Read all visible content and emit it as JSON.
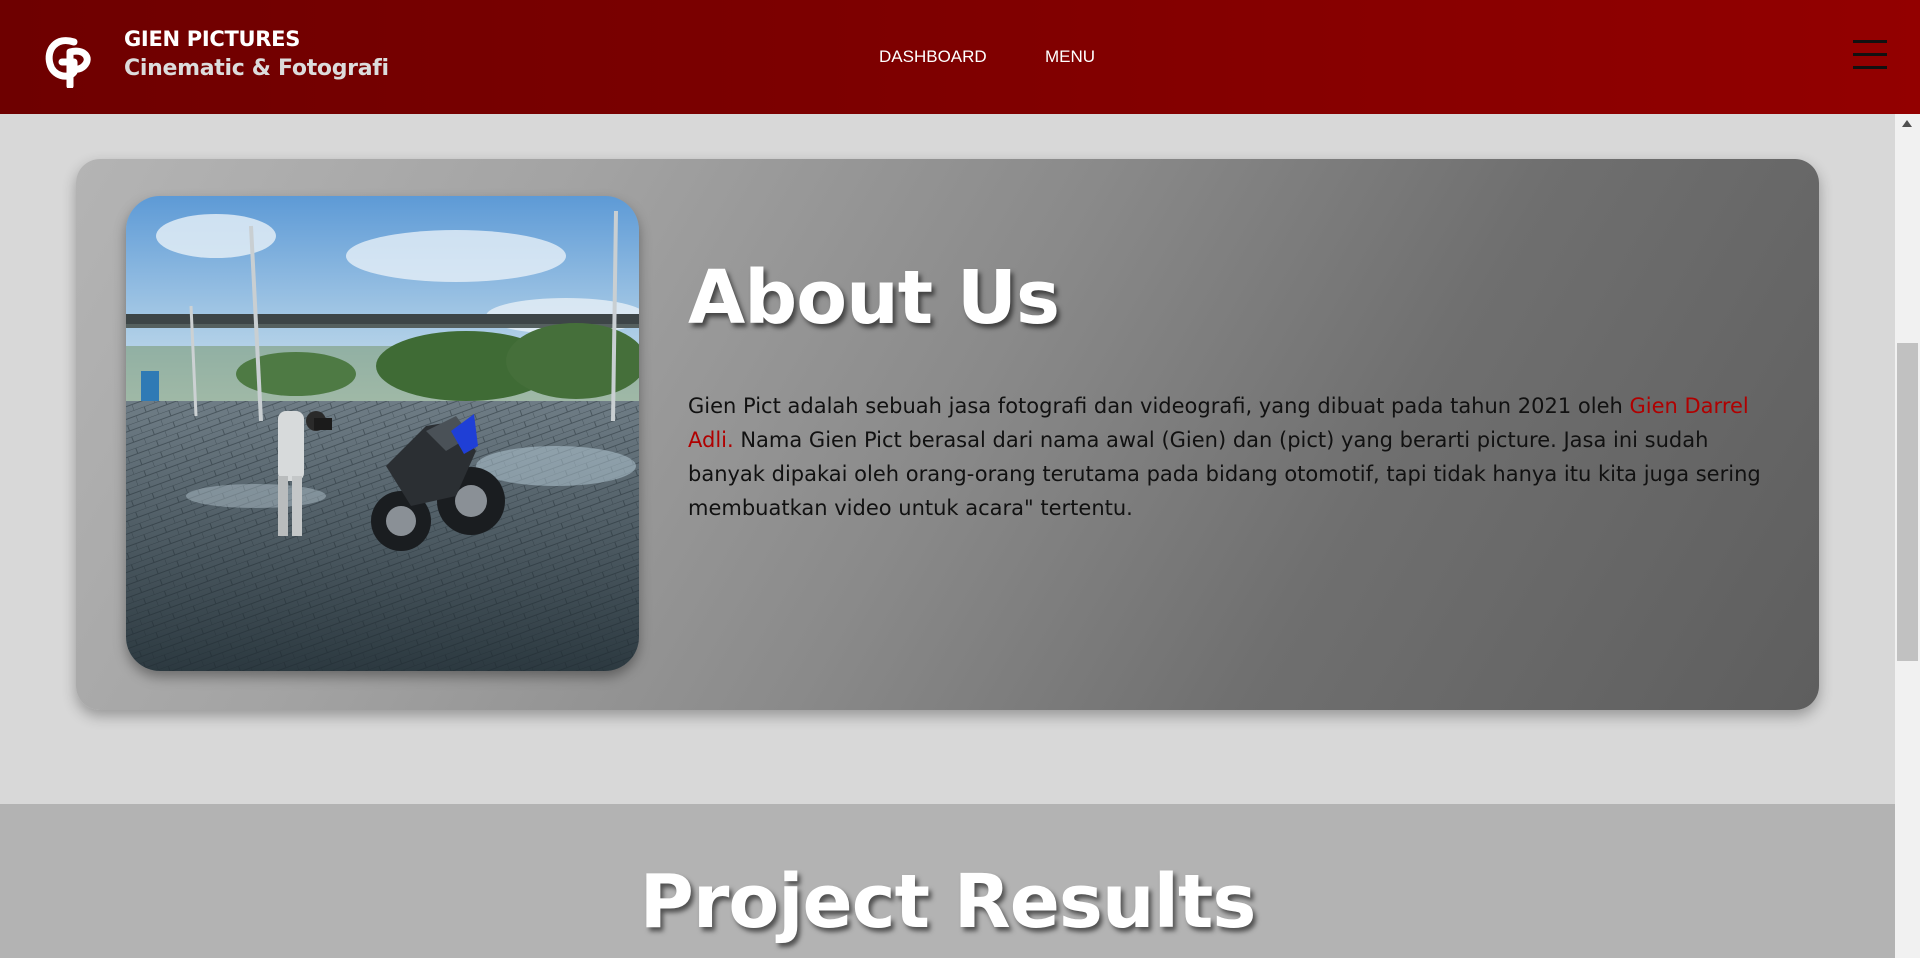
{
  "header": {
    "logo_icon": "gp-logo-icon",
    "brand_title": "GIEN PICTURES",
    "brand_subtitle": "Cinematic & Fotografi",
    "nav": [
      {
        "label": "DASHBOARD"
      },
      {
        "label": "MENU"
      }
    ],
    "menu_icon": "hamburger-icon",
    "colors": {
      "header_start": "#6e0000",
      "header_end": "#930000"
    }
  },
  "about": {
    "title": "About Us",
    "image_icon": "photographer-motorcycle-photo",
    "paragraph_start": "Gien Pict adalah sebuah jasa fotografi dan videografi, yang dibuat pada tahun 2021 oleh ",
    "highlight_name": "Gien Darrel Adli.",
    "paragraph_end": " Nama Gien Pict berasal dari nama awal (Gien) dan (pict) yang berarti picture. Jasa ini sudah banyak dipakai oleh orang-orang terutama pada bidang otomotif, tapi tidak hanya itu kita juga sering membuatkan video untuk acara\" tertentu.",
    "highlight_color": "#b00000"
  },
  "projects": {
    "title": "Project Results"
  }
}
